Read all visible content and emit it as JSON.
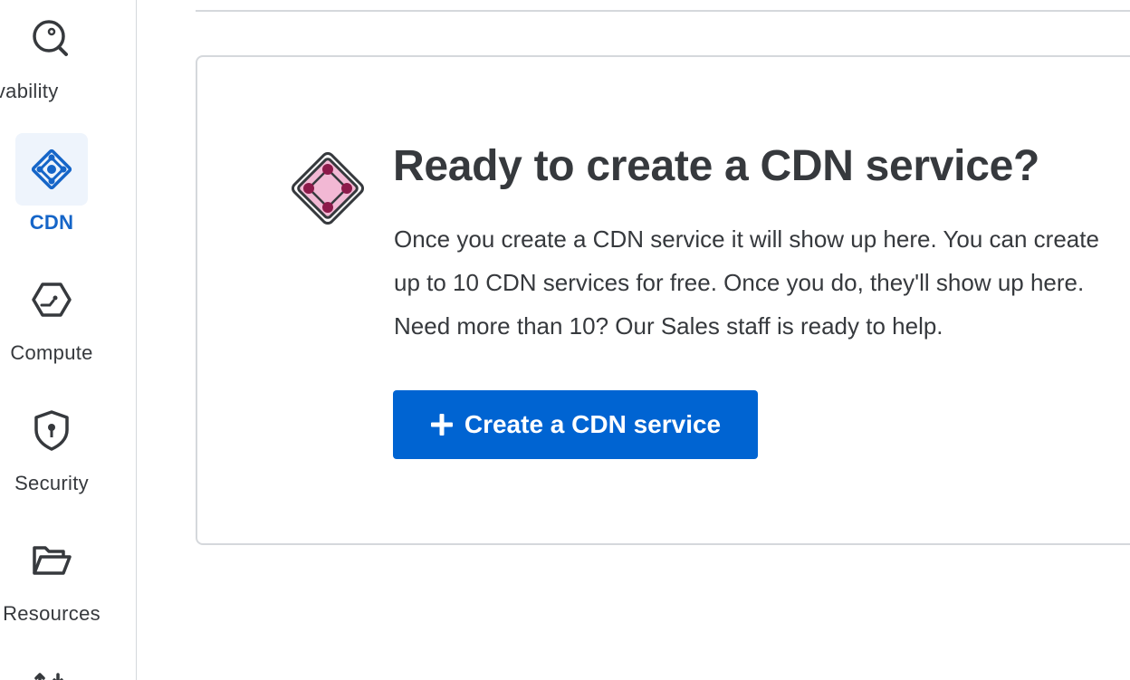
{
  "sidebar": {
    "items": [
      {
        "label": "Observability",
        "icon": "observability-icon",
        "active": false
      },
      {
        "label": "CDN",
        "icon": "cdn-icon",
        "active": true
      },
      {
        "label": "Compute",
        "icon": "compute-icon",
        "active": false
      },
      {
        "label": "Security",
        "icon": "security-icon",
        "active": false
      },
      {
        "label": "Resources",
        "icon": "resources-icon",
        "active": false
      },
      {
        "label": "",
        "icon": "transfer-icon",
        "active": false
      }
    ]
  },
  "main": {
    "empty_state": {
      "icon": "cdn-service-icon",
      "heading": "Ready to create a CDN service?",
      "body": "Once you create a CDN service it will show up here. You can create up to 10 CDN services for free. Once you do, they'll show up here. Need more than 10? Our Sales staff is ready to help.",
      "button_label": "Create a CDN service",
      "button_icon": "plus-icon"
    }
  },
  "colors": {
    "accent": "#0064d2",
    "active_label": "#1565c8",
    "active_tile": "#eef4fc",
    "text": "#36393d",
    "border": "#d5d8dc",
    "badge_fill": "#f2b8d4",
    "badge_dots": "#8c1a4a"
  }
}
